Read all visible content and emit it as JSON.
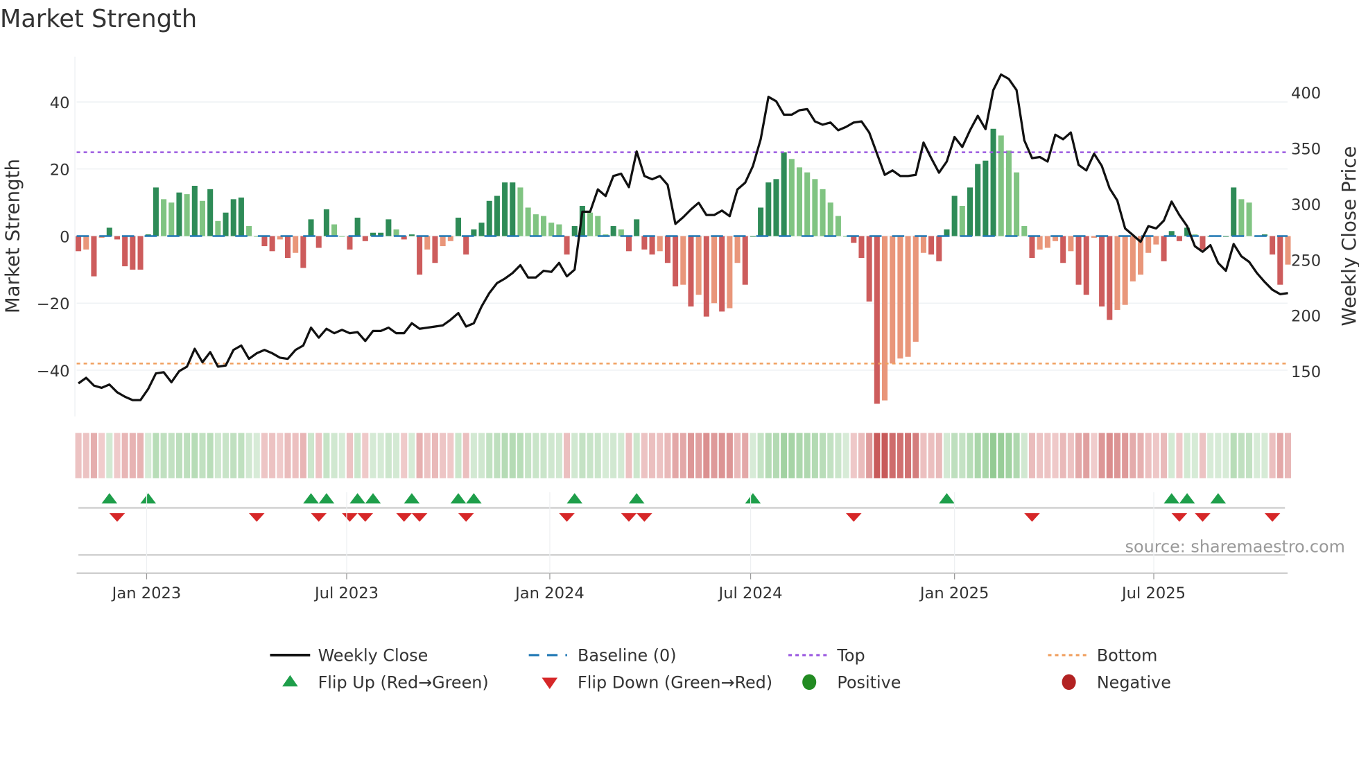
{
  "title": "Market Strength",
  "source": "source: sharemaestro.com",
  "colors": {
    "close": "#111111",
    "baseline": "#1f77b4",
    "top": "#9b59e0",
    "bottom": "#f0a060",
    "green_rising": "#2e8b57",
    "green_falling": "#80c482",
    "red_falling": "#cd5c5c",
    "red_rising": "#e9967a",
    "flip_up": "#1e9e4a",
    "flip_down": "#d62728",
    "positive": "#228b22",
    "negative": "#b22222"
  },
  "chart_data": {
    "type": "bar+line",
    "title": "Market Strength",
    "ylabel": "Market Strength",
    "y2label": "Weekly Close Price",
    "ylim": [
      -53,
      54
    ],
    "y2lim": [
      108,
      445
    ],
    "yticks": [
      40,
      20,
      0,
      -20,
      -40
    ],
    "yticklabels": [
      "40",
      "20",
      "0",
      "−20",
      "−40"
    ],
    "y2ticks": [
      400,
      350,
      300,
      250,
      200,
      150
    ],
    "y2ticklabels": [
      "400",
      "350",
      "300",
      "250",
      "200",
      "150"
    ],
    "top_level": 25,
    "bottom_level": -38,
    "baseline_level": 0,
    "x_unit": "week index",
    "xticks": [
      {
        "week": 8.8,
        "label": "Jan 2023"
      },
      {
        "week": 34.6,
        "label": "Jul 2023"
      },
      {
        "week": 60.8,
        "label": "Jan 2024"
      },
      {
        "week": 86.7,
        "label": "Jul 2024"
      },
      {
        "week": 113,
        "label": "Jan 2025"
      },
      {
        "week": 138.7,
        "label": "Jul 2025"
      }
    ],
    "strength": [
      -4.5,
      -4,
      -12,
      -0.5,
      2.5,
      -1,
      -9,
      -10,
      -10,
      0.5,
      14.5,
      11,
      10,
      13,
      12.5,
      15,
      10.5,
      14,
      4.5,
      7,
      11,
      11.5,
      3,
      0,
      -3,
      -4.5,
      -1,
      -6.5,
      -5,
      -9.5,
      5,
      -3.5,
      8,
      3.5,
      0,
      -4,
      5.5,
      -1.5,
      1,
      1,
      5,
      2,
      -1,
      0.5,
      -11.5,
      -4,
      -8,
      -3,
      -1.5,
      5.5,
      -5.5,
      2,
      4,
      10.5,
      12,
      16,
      16,
      14.5,
      8.5,
      6.5,
      6,
      4,
      3.5,
      -5.5,
      3,
      9,
      7,
      6,
      0.5,
      3,
      2,
      -4.5,
      5,
      -4,
      -5.5,
      -4.5,
      -8,
      -15,
      -14.5,
      -21,
      -17.5,
      -24,
      -20,
      -22.5,
      -21.5,
      -8,
      -14.5,
      0,
      8.5,
      16,
      17,
      25,
      23,
      20.5,
      19,
      17,
      14,
      10,
      6,
      0,
      -2,
      -6.5,
      -19.5,
      -50,
      -49,
      -38,
      -36.5,
      -36,
      -31.5,
      -5,
      -5.5,
      -7.5,
      2,
      12,
      9,
      14.5,
      21.5,
      22.5,
      32,
      30,
      25.5,
      19,
      3,
      -6.5,
      -4,
      -3.5,
      -1.5,
      -8,
      -4.5,
      -14.5,
      -17.5,
      -0.5,
      -21,
      -25,
      -22,
      -20.5,
      -13.5,
      -11.5,
      -5,
      -2.5,
      -7.5,
      1.5,
      -1.5,
      2.5,
      0.5,
      -4,
      0,
      0,
      0,
      14.5,
      11,
      10,
      0,
      0.5,
      -5.5,
      -14.5,
      -8.5
    ],
    "weekly_close": [
      139,
      144,
      137,
      135,
      138,
      131,
      127,
      124,
      124,
      134,
      148,
      149,
      140,
      150,
      154,
      170,
      158,
      167,
      154,
      155,
      169,
      173,
      161,
      166,
      169,
      166,
      162,
      161,
      169,
      173,
      189,
      180,
      188,
      184,
      187,
      184,
      185,
      177,
      186,
      186,
      189,
      184,
      184,
      193,
      188,
      189,
      190,
      191,
      196,
      202,
      190,
      193,
      208,
      220,
      229,
      233,
      238,
      245,
      234,
      234,
      240,
      239,
      247,
      235,
      241,
      293,
      293,
      313,
      307,
      325,
      327,
      315,
      347,
      325,
      322,
      325,
      317,
      282,
      288,
      295,
      301,
      290,
      290,
      294,
      289,
      313,
      319,
      334,
      358,
      396,
      392,
      380,
      380,
      384,
      385,
      374,
      371,
      373,
      366,
      369,
      373,
      374,
      364,
      345,
      326,
      330,
      325,
      325,
      326,
      355,
      341,
      328,
      338,
      360,
      351,
      366,
      379,
      367,
      402,
      416,
      412,
      402,
      357,
      341,
      342,
      338,
      362,
      358,
      364,
      335,
      330,
      345,
      334,
      314,
      303,
      278,
      272,
      266,
      280,
      278,
      285,
      302,
      290,
      280,
      262,
      257,
      263,
      247,
      240,
      264,
      253,
      248,
      238,
      230,
      223,
      219,
      220
    ],
    "flip_up_weeks": [
      4,
      9,
      30,
      32,
      36,
      38,
      43,
      49,
      51,
      64,
      72,
      87,
      112,
      141,
      143,
      147
    ],
    "flip_down_weeks": [
      5,
      23,
      31,
      35,
      37,
      42,
      44,
      50,
      63,
      71,
      73,
      100,
      123,
      142,
      145,
      154
    ]
  },
  "legend": {
    "weekly_close": "Weekly Close",
    "baseline": "Baseline (0)",
    "top": "Top",
    "bottom": "Bottom",
    "flip_up": "Flip Up (Red→Green)",
    "flip_down": "Flip Down (Green→Red)",
    "positive": "Positive",
    "negative": "Negative"
  }
}
